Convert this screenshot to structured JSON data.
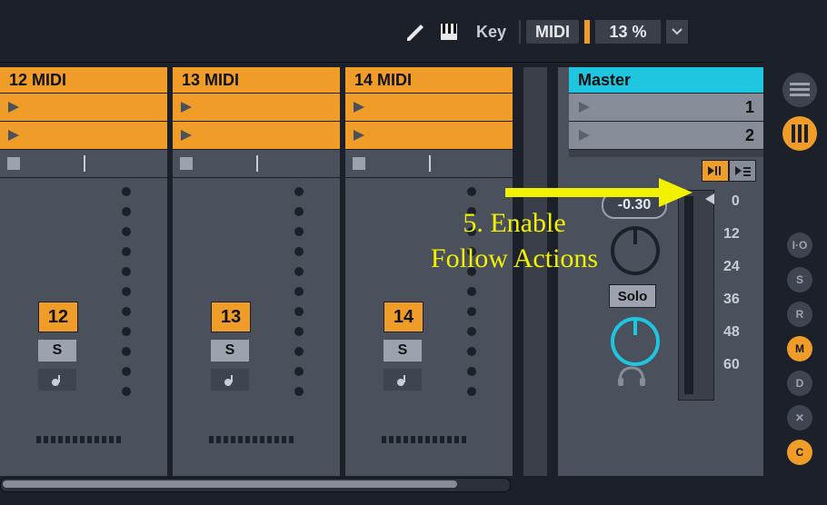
{
  "toolbar": {
    "key_label": "Key",
    "midi_label": "MIDI",
    "percent_value": "13 %"
  },
  "tracks": [
    {
      "name": "12 MIDI",
      "number": "12",
      "solo": "S"
    },
    {
      "name": "13 MIDI",
      "number": "13",
      "solo": "S"
    },
    {
      "name": "14 MIDI",
      "number": "14",
      "solo": "S"
    }
  ],
  "master": {
    "title": "Master",
    "scenes": [
      "1",
      "2"
    ],
    "readout": "-0.30",
    "solo_label": "Solo",
    "db_ticks": [
      "0",
      "12",
      "24",
      "36",
      "48",
      "60"
    ]
  },
  "rail": {
    "io_label": "I·O",
    "s_label": "S",
    "r_label": "R",
    "m_label": "M",
    "d_label": "D",
    "x_label": "✕",
    "c_label": "C"
  },
  "annotation": {
    "text": "5. Enable Follow Actions"
  },
  "colors": {
    "accent": "#f09c28",
    "master": "#1fc6e0",
    "arrow": "#f2f200"
  }
}
